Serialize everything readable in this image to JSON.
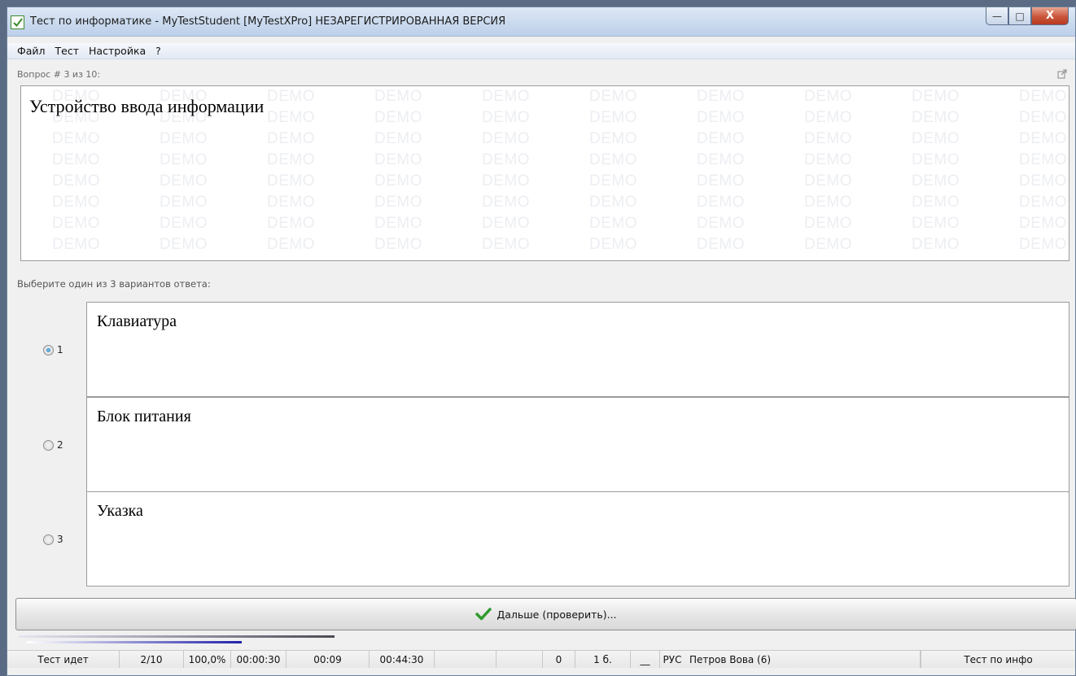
{
  "window": {
    "title": "Тест по информатике - MyTestStudent [MyTestXPro] НЕЗАРЕГИСТРИРОВАННАЯ ВЕРСИЯ",
    "minimize_glyph": "—",
    "maximize_glyph": "□",
    "close_glyph": "X"
  },
  "menu": {
    "items": [
      {
        "label": "Файл"
      },
      {
        "label": "Тест"
      },
      {
        "label": "Настройка"
      },
      {
        "label": "?"
      }
    ]
  },
  "question": {
    "counter": "Вопрос # 3 из 10:",
    "text": "Устройство ввода информации",
    "watermark_text": "DEMO"
  },
  "instruction": "Выберите один из 3 вариантов ответа:",
  "answers": [
    {
      "number": "1",
      "text": "Клавиатура",
      "selected": true
    },
    {
      "number": "2",
      "text": "Блок питания",
      "selected": false
    },
    {
      "number": "3",
      "text": "Указка",
      "selected": false
    }
  ],
  "next_button": {
    "label": "Дальше (проверить)...",
    "icon": "check-icon",
    "icon_color": "#2e9b2e"
  },
  "progress": {
    "fraction": 0.68
  },
  "status": {
    "state": "Тест идет",
    "question_progress": "2/10",
    "percent": "100,0%",
    "elapsed": "00:00:30",
    "question_time": "00:09",
    "time_left": "00:44:30",
    "empty1": "",
    "empty2": "",
    "score": "0",
    "points": "1 б.",
    "underscore": "__",
    "lang": "РУС",
    "student": "Петров Вова (6)",
    "test_name": "Тест по инфо"
  },
  "colors": {
    "accent": "#3c8a2b",
    "close_button": "#c9553a",
    "progress": "#2222aa"
  }
}
